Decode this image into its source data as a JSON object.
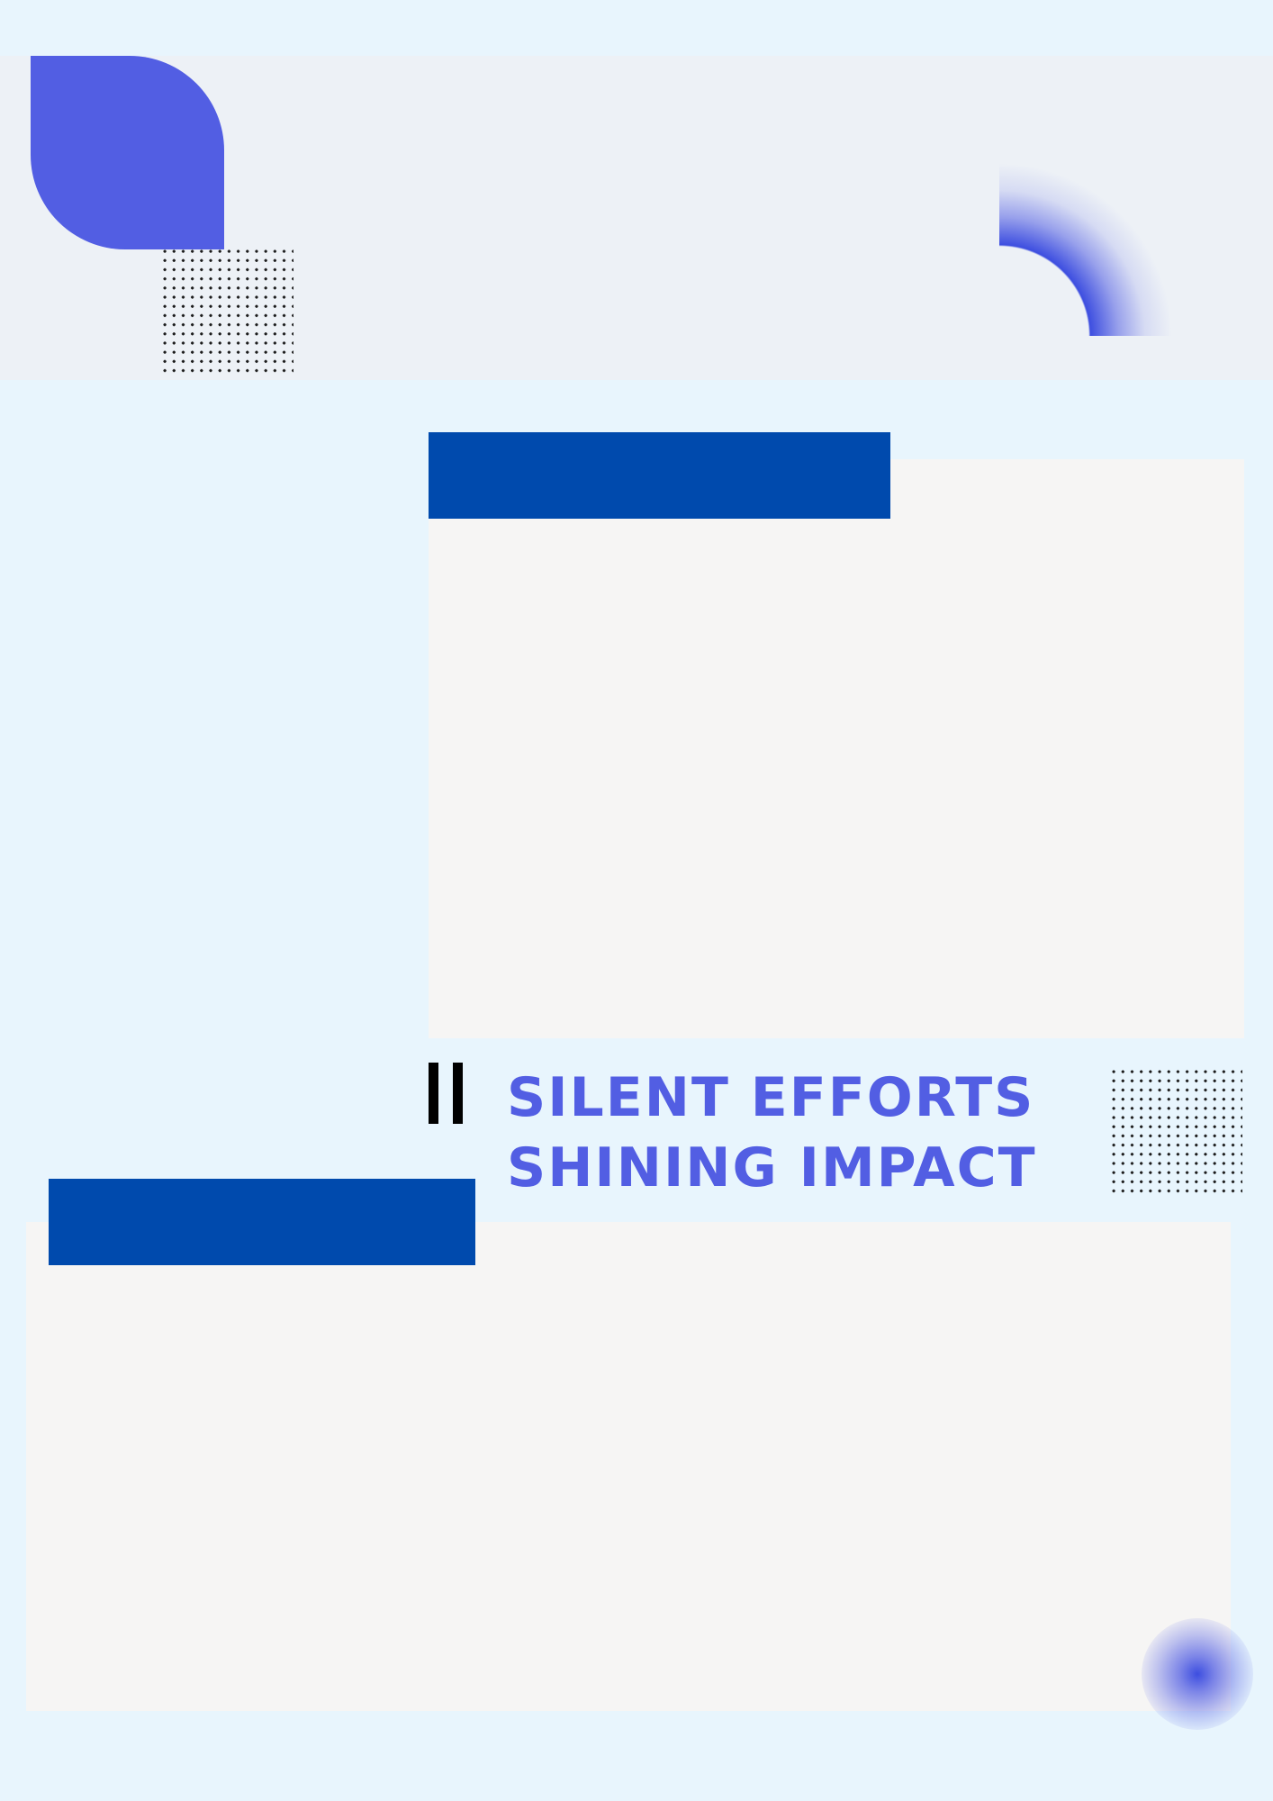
{
  "headline": {
    "line1": "SILENT EFFORTS",
    "line2": "SHINING IMPACT"
  },
  "colors": {
    "background": "#e8f5fd",
    "band": "#edf1f6",
    "accent": "#525ee3",
    "bar": "#004aad",
    "panel": "#f6f5f4"
  }
}
